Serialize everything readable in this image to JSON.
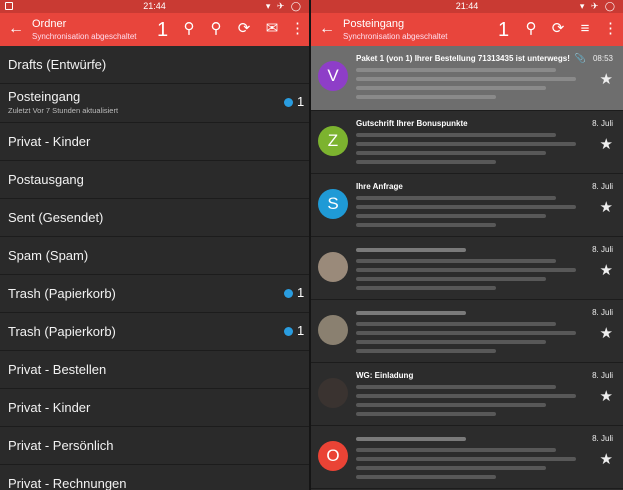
{
  "status_bar": {
    "time": "21:44",
    "right_icons": "▾ ✈ ◯"
  },
  "left": {
    "title": "Ordner",
    "subtitle": "Synchronisation abgeschaltet",
    "count": "1",
    "folders": [
      {
        "name": "Drafts (Entwürfe)"
      },
      {
        "name": "Posteingang",
        "sub": "Zuletzt Vor 7 Stunden aktualisiert",
        "unread": "1"
      },
      {
        "name": "Privat - Kinder"
      },
      {
        "name": "Postausgang"
      },
      {
        "name": "Sent (Gesendet)"
      },
      {
        "name": "Spam (Spam)"
      },
      {
        "name": "Trash (Papierkorb)",
        "unread": "1"
      },
      {
        "name": "Trash (Papierkorb)",
        "unread": "1"
      },
      {
        "name": "Privat - Bestellen"
      },
      {
        "name": "Privat - Kinder"
      },
      {
        "name": "Privat - Persönlich"
      },
      {
        "name": "Privat - Rechnungen"
      }
    ]
  },
  "right": {
    "title": "Posteingang",
    "subtitle": "Synchronisation abgeschaltet",
    "count": "1",
    "messages": [
      {
        "avatar": "V",
        "color": "#8e3ec8",
        "subject": "Paket 1 (von 1) Ihrer Bestellung 71313435 ist unterwegs!",
        "date": "08:53"
      },
      {
        "avatar": "Z",
        "color": "#7cb32f",
        "subject": "Gutschrift Ihrer Bonuspunkte",
        "date": "8. Juli"
      },
      {
        "avatar": "S",
        "color": "#1f9ad6",
        "subject": "Ihre Anfrage",
        "date": "8. Juli"
      },
      {
        "avatar": "",
        "color": "#9a8a7a",
        "subject": "",
        "date": "8. Juli"
      },
      {
        "avatar": "",
        "color": "#8a8070",
        "subject": "",
        "date": "8. Juli"
      },
      {
        "avatar": "",
        "color": "#3a3330",
        "subject": "WG: Einladung",
        "date": "8. Juli"
      },
      {
        "avatar": "O",
        "color": "#ea4335",
        "subject": "",
        "date": "8. Juli"
      }
    ]
  }
}
